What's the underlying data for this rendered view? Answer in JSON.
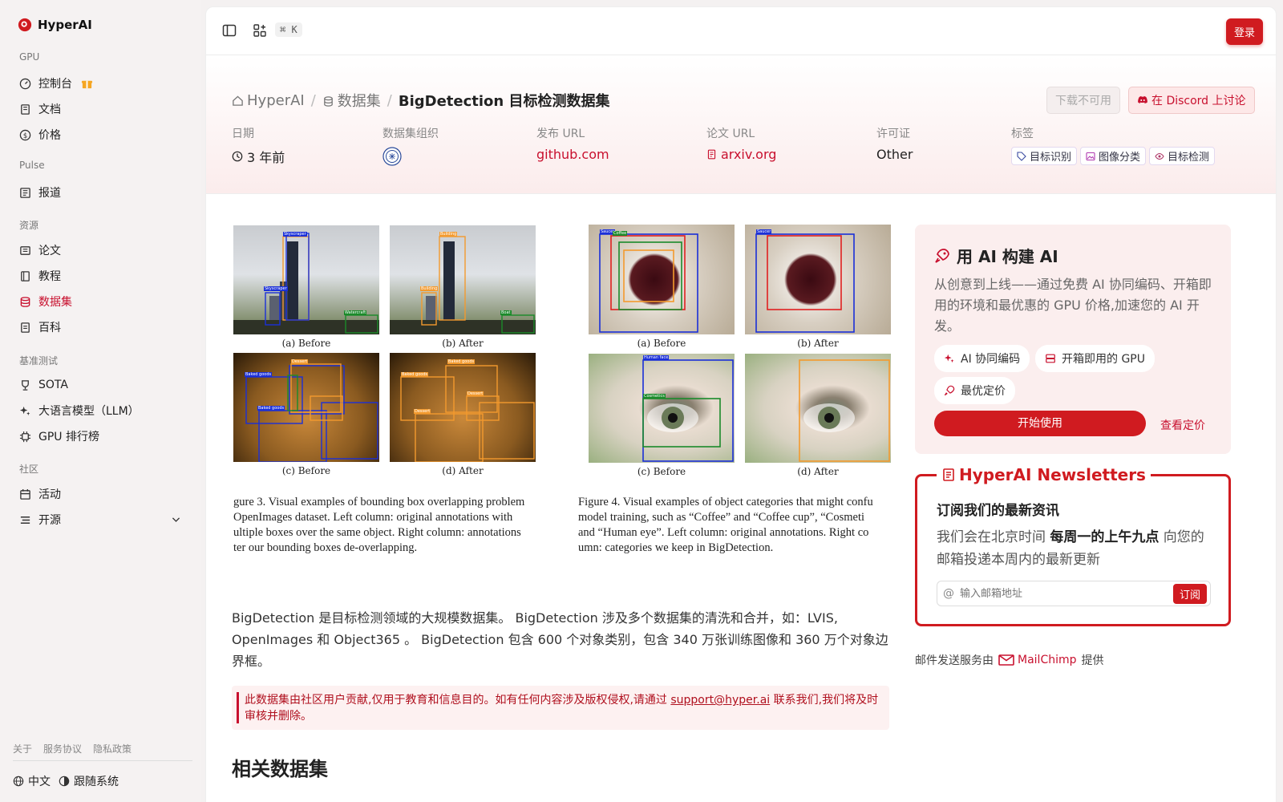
{
  "brand": {
    "name": "HyperAI"
  },
  "sidebar": {
    "sections": [
      {
        "label": "GPU"
      },
      {
        "label": "Pulse"
      },
      {
        "label": "资源"
      },
      {
        "label": "基准测试"
      },
      {
        "label": "社区"
      }
    ],
    "items": [
      {
        "label": "控制台"
      },
      {
        "label": "文档"
      },
      {
        "label": "价格"
      },
      {
        "label": "报道"
      },
      {
        "label": "论文"
      },
      {
        "label": "教程"
      },
      {
        "label": "数据集"
      },
      {
        "label": "百科"
      },
      {
        "label": "SOTA"
      },
      {
        "label": "大语言模型（LLM）"
      },
      {
        "label": "GPU 排行榜"
      },
      {
        "label": "活动"
      },
      {
        "label": "开源"
      }
    ],
    "footer_links": [
      "关于",
      "服务协议",
      "隐私政策"
    ],
    "language": "中文",
    "theme": "跟随系统"
  },
  "topbar": {
    "shortcut": "⌘ K",
    "login": "登录"
  },
  "breadcrumb": {
    "home": "HyperAI",
    "datasets": "数据集",
    "current": "BigDetection 目标检测数据集"
  },
  "actions": {
    "download": "下载不可用",
    "discord": "在 Discord 上讨论"
  },
  "meta": {
    "date_label": "日期",
    "date_value": "3 年前",
    "org_label": "数据集组织",
    "release_label": "发布 URL",
    "release_value": "github.com",
    "paper_label": "论文 URL",
    "paper_value": "arxiv.org",
    "license_label": "许可证",
    "license_value": "Other",
    "tags_label": "标签",
    "tags": [
      "目标识别",
      "图像分类",
      "目标检测"
    ]
  },
  "figure": {
    "captions_left": [
      "(a) Before",
      "(b) After",
      "(c) Before",
      "(d) After"
    ],
    "captions_right": [
      "(a) Before",
      "(b) After",
      "(c) Before",
      "(d) After"
    ],
    "fig3_lines": [
      "gure 3.  Visual examples of bounding box overlapping problem",
      "OpenImages dataset.  Left column:  original annotations with",
      "ultiple boxes over the same object.  Right column:  annotations",
      "ter our bounding boxes de-overlapping."
    ],
    "fig4_lines": [
      "Figure 4.  Visual examples of object categories that might confu",
      "model training, such as “Coffee” and “Coffee cup”, “Cosmeti",
      "and “Human eye”.  Left column: original annotations. Right co",
      "umn: categories we keep in BigDetection."
    ],
    "box_labels": [
      "Skyscraper",
      "Skyscraper",
      "Watercraft",
      "Building",
      "Building",
      "Boat",
      "Baked goods",
      "Baked goods",
      "Dessert",
      "Baked goods",
      "Baked goods",
      "Dessert",
      "Dessert",
      "Dessert",
      "Dessert",
      "Saucer",
      "Coffee",
      "Saucer",
      "Human face",
      "Cosmetics"
    ]
  },
  "description": "BigDetection 是目标检测领域的大规模数据集。 BigDetection 涉及多个数据集的清洗和合并，如：LVIS, OpenImages 和 Object365 。 BigDetection 包含 600 个对象类别，包含 340 万张训练图像和 360 万个对象边界框。",
  "notice": {
    "prefix": "此数据集由社区用户贡献,仅用于教育和信息目的。如有任何内容涉及版权侵权,请通过 ",
    "email": "support@hyper.ai",
    "suffix": " 联系我们,我们将及时审核并删除。"
  },
  "related_title": "相关数据集",
  "promo": {
    "title": "用 AI 构建 AI",
    "text": "从创意到上线——通过免费 AI 协同编码、开箱即用的环境和最优惠的 GPU 价格,加速您的 AI 开发。",
    "chips": [
      "AI 协同编码",
      "开箱即用的 GPU",
      "最优定价"
    ],
    "start": "开始使用",
    "pricing": "查看定价"
  },
  "newsletter": {
    "title": "HyperAI Newsletters",
    "heading": "订阅我们的最新资讯",
    "text_pre": "我们会在北京时间 ",
    "text_bold": "每周一的上午九点",
    "text_post": " 向您的邮箱投递本周内的最新更新",
    "placeholder": "输入邮箱地址",
    "subscribe": "订阅"
  },
  "powered": {
    "prefix": "邮件发送服务由",
    "name": "MailChimp",
    "suffix": "提供"
  },
  "colors": {
    "accent": "#d01b20",
    "box_blue": "#1a2fd8",
    "box_orange": "#f39a2e",
    "box_green": "#1a8a2a",
    "box_red": "#e02020"
  }
}
